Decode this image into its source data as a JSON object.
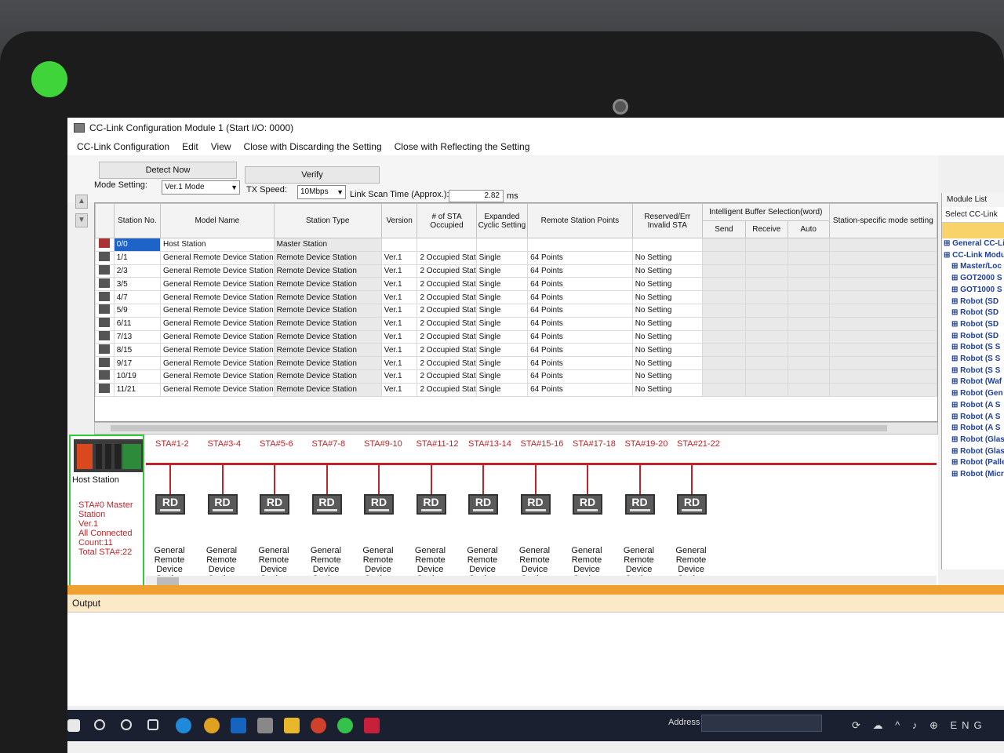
{
  "window": {
    "title": "CC-Link Configuration Module 1 (Start I/O: 0000)"
  },
  "menu": [
    "CC-Link Configuration",
    "Edit",
    "View",
    "Close with Discarding the Setting",
    "Close with Reflecting the Setting"
  ],
  "toolbar": {
    "detect_now": "Detect Now",
    "verify": "Verify",
    "mode_label": "Mode Setting:",
    "mode_value": "Ver.1 Mode",
    "tx_label": "TX Speed:",
    "tx_value": "10Mbps",
    "scan_label": "Link Scan Time (Approx.):",
    "scan_value": "2.82",
    "scan_unit": "ms"
  },
  "grid": {
    "headers": [
      "Station No.",
      "Model Name",
      "Station Type",
      "Version",
      "# of STA Occupied",
      "Expanded Cyclic Setting",
      "Remote Station Points",
      "Reserved/Err Invalid STA",
      "Intelligent Buffer Selection(word)",
      "Station-specific mode setting"
    ],
    "subheaders": [
      "Send",
      "Receive",
      "Auto"
    ],
    "rows": [
      {
        "station": "0/0",
        "model": "Host Station",
        "type": "Master Station",
        "version": "",
        "occupied": "",
        "cyclic": "",
        "points": "",
        "reserved": ""
      },
      {
        "station": "1/1",
        "model": "General Remote Device Station",
        "type": "Remote Device Station",
        "version": "Ver.1",
        "occupied": "2 Occupied Stat",
        "cyclic": "Single",
        "points": "64 Points",
        "reserved": "No Setting"
      },
      {
        "station": "2/3",
        "model": "General Remote Device Station",
        "type": "Remote Device Station",
        "version": "Ver.1",
        "occupied": "2 Occupied Stat",
        "cyclic": "Single",
        "points": "64 Points",
        "reserved": "No Setting"
      },
      {
        "station": "3/5",
        "model": "General Remote Device Station",
        "type": "Remote Device Station",
        "version": "Ver.1",
        "occupied": "2 Occupied Stat",
        "cyclic": "Single",
        "points": "64 Points",
        "reserved": "No Setting"
      },
      {
        "station": "4/7",
        "model": "General Remote Device Station",
        "type": "Remote Device Station",
        "version": "Ver.1",
        "occupied": "2 Occupied Stat",
        "cyclic": "Single",
        "points": "64 Points",
        "reserved": "No Setting"
      },
      {
        "station": "5/9",
        "model": "General Remote Device Station",
        "type": "Remote Device Station",
        "version": "Ver.1",
        "occupied": "2 Occupied Stat",
        "cyclic": "Single",
        "points": "64 Points",
        "reserved": "No Setting"
      },
      {
        "station": "6/11",
        "model": "General Remote Device Station",
        "type": "Remote Device Station",
        "version": "Ver.1",
        "occupied": "2 Occupied Stat",
        "cyclic": "Single",
        "points": "64 Points",
        "reserved": "No Setting"
      },
      {
        "station": "7/13",
        "model": "General Remote Device Station",
        "type": "Remote Device Station",
        "version": "Ver.1",
        "occupied": "2 Occupied Stat",
        "cyclic": "Single",
        "points": "64 Points",
        "reserved": "No Setting"
      },
      {
        "station": "8/15",
        "model": "General Remote Device Station",
        "type": "Remote Device Station",
        "version": "Ver.1",
        "occupied": "2 Occupied Stat",
        "cyclic": "Single",
        "points": "64 Points",
        "reserved": "No Setting"
      },
      {
        "station": "9/17",
        "model": "General Remote Device Station",
        "type": "Remote Device Station",
        "version": "Ver.1",
        "occupied": "2 Occupied Stat",
        "cyclic": "Single",
        "points": "64 Points",
        "reserved": "No Setting"
      },
      {
        "station": "10/19",
        "model": "General Remote Device Station",
        "type": "Remote Device Station",
        "version": "Ver.1",
        "occupied": "2 Occupied Stat",
        "cyclic": "Single",
        "points": "64 Points",
        "reserved": "No Setting"
      },
      {
        "station": "11/21",
        "model": "General Remote Device Station",
        "type": "Remote Device Station",
        "version": "Ver.1",
        "occupied": "2 Occupied Stat",
        "cyclic": "Single",
        "points": "64 Points",
        "reserved": "No Setting"
      }
    ]
  },
  "diagram": {
    "host_label": "Host Station",
    "host_info": [
      "STA#0  Master Station",
      "Ver.1",
      "All Connected Count:11",
      "Total STA#:22"
    ],
    "station_labels": [
      "STA#1-2",
      "STA#3-4",
      "STA#5-6",
      "STA#7-8",
      "STA#9-10",
      "STA#11-12",
      "STA#13-14",
      "STA#15-16",
      "STA#17-18",
      "STA#19-20",
      "STA#21-22"
    ],
    "rd_text": "RD",
    "station_name": "General Remote Device Station",
    "bus_color": "#c0242a"
  },
  "output": {
    "title": "Output"
  },
  "module_list": {
    "title": "Module List",
    "select": "Select CC-Link",
    "items": [
      "General CC-Li",
      "CC-Link Modu",
      "Master/Loc",
      "GOT2000 S",
      "GOT1000 S",
      "Robot (SD",
      "Robot (SD",
      "Robot (SD",
      "Robot (SD",
      "Robot (S S",
      "Robot (S S",
      "Robot (S S",
      "Robot (Waf",
      "Robot (Gen",
      "Robot (A S",
      "Robot (A S",
      "Robot (A S",
      "Robot (Glas",
      "Robot (Glas",
      "Robot (Palle",
      "Robot (Micr"
    ]
  },
  "taskbar": {
    "address_label": "Address",
    "tray_text": "ENG"
  }
}
